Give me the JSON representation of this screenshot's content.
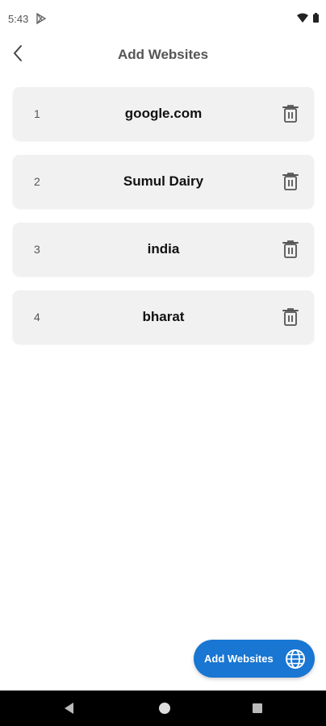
{
  "status_bar": {
    "time": "5:43",
    "icons": [
      "play-store-icon",
      "wifi-icon",
      "battery-icon"
    ]
  },
  "app_bar": {
    "title": "Add Websites",
    "back_icon": "chevron-left-icon"
  },
  "websites": [
    {
      "index": "1",
      "label": "google.com"
    },
    {
      "index": "2",
      "label": "Sumul Dairy"
    },
    {
      "index": "3",
      "label": "india"
    },
    {
      "index": "4",
      "label": "bharat"
    }
  ],
  "fab": {
    "label": "Add Websites",
    "icon": "globe-icon",
    "color": "#1976d2"
  },
  "nav_bar": {
    "icons": [
      "back-triangle-icon",
      "home-circle-icon",
      "recents-square-icon"
    ]
  }
}
